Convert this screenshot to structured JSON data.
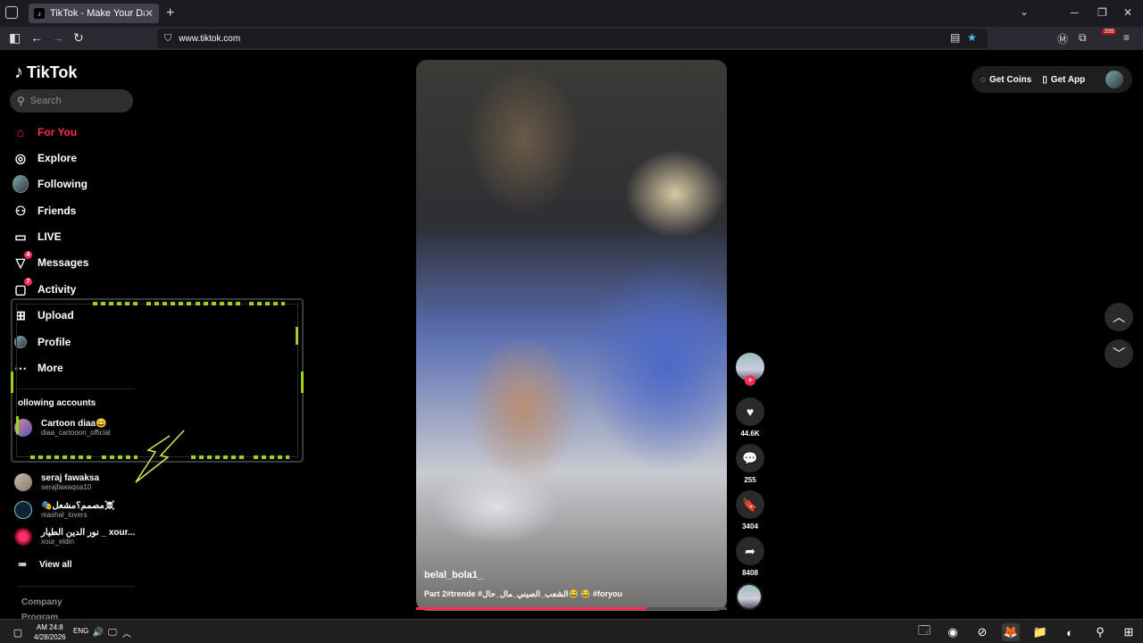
{
  "browser": {
    "tab_title": "TikTok - Make Your Day",
    "url": "www.tiktok.com",
    "ext_badge": "399"
  },
  "sidebar": {
    "logo": "TikTok",
    "search_placeholder": "Search",
    "nav": [
      {
        "label": "For You",
        "icon": "home-icon"
      },
      {
        "label": "Explore",
        "icon": "compass-icon"
      },
      {
        "label": "Following",
        "icon": "avatar-icon"
      },
      {
        "label": "Friends",
        "icon": "friends-icon"
      },
      {
        "label": "LIVE",
        "icon": "live-icon"
      },
      {
        "label": "Messages",
        "icon": "messages-icon",
        "badge": "4"
      },
      {
        "label": "Activity",
        "icon": "activity-icon",
        "badge": "7"
      },
      {
        "label": "Upload",
        "icon": "upload-icon"
      },
      {
        "label": "Profile",
        "icon": "profile-icon"
      },
      {
        "label": "More",
        "icon": "more-icon"
      }
    ],
    "following_title": "ollowing accounts",
    "accounts": [
      {
        "name": "Cartoon diaa😄",
        "handle": "diaa_cartooon_official"
      },
      {
        "name": "seraj fawaksa",
        "handle": "serajfawaqsa10"
      },
      {
        "name": "🎭مصمم؟مشعل☠️",
        "handle": "mashal_lovers"
      },
      {
        "name": "نور الدين الطيار _ xour...",
        "handle": "xour_eldin"
      }
    ],
    "view_all": "View all",
    "footer": [
      "Company",
      "Program"
    ]
  },
  "video": {
    "author": "belal_bola1_",
    "caption": "Part 2#trende #الشعب_الصيني_مال_حال😂 😂 #foryou",
    "progress": 0.74
  },
  "actions": {
    "likes": "44.6K",
    "comments": "255",
    "saves": "3404",
    "shares": "8408"
  },
  "header_right": {
    "coins": "Get Coins",
    "app": "Get App"
  },
  "taskbar": {
    "time": "AM 24:8",
    "date": "4/28/2026",
    "lang": "ENG"
  },
  "colors": {
    "accent": "#fe2c55",
    "hud": "#9bd11f"
  }
}
